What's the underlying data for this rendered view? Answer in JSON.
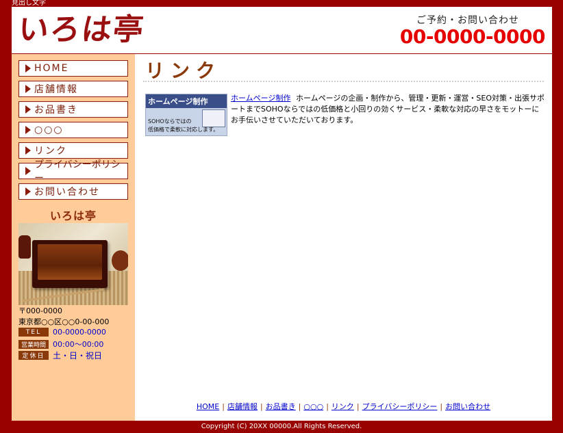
{
  "top_caption": "見出し文字",
  "header": {
    "logo_text": "いろは亭",
    "reserve_label": "ご予約・お問い合わせ",
    "phone": "00-0000-0000"
  },
  "nav": {
    "items": [
      {
        "label": "HOME"
      },
      {
        "label": "店舗情報"
      },
      {
        "label": "お品書き"
      },
      {
        "label": "○○○"
      },
      {
        "label": "リンク"
      },
      {
        "label": "プライバシーポリシー"
      },
      {
        "label": "お問い合わせ"
      }
    ]
  },
  "sidebar": {
    "title": "いろは亭",
    "postal": "〒000-0000",
    "address": "東京都○○区○○0-00-000",
    "tel_label": "TEL",
    "tel_value": "00-0000-0000",
    "hours_label": "営業時間",
    "hours_value": "00:00～00:00",
    "closed_label": "定休日",
    "closed_value": "土・日・祝日"
  },
  "main": {
    "title": "リンク",
    "banner": {
      "title": "ホームページ制作",
      "line1": "SOHOならではの",
      "line2": "低価格で柔軟に対応します。"
    },
    "link_label": "ホームページ制作",
    "link_desc": "ホームページの企画・制作から、管理・更新・運営・SEO対策・出張サポートまでSOHOならではの低価格と小回りの効くサービス・柔軟な対応の早さをモットーにお手伝いさせていただいております。"
  },
  "footer": {
    "links": [
      {
        "label": "HOME"
      },
      {
        "label": "店舗情報"
      },
      {
        "label": "お品書き"
      },
      {
        "label": "○○○"
      },
      {
        "label": "リンク"
      },
      {
        "label": "プライバシーポリシー"
      },
      {
        "label": "お問い合わせ"
      }
    ],
    "separator": "|",
    "copyright": "Copyright (C) 20XX 00000.All Rights Reserved."
  },
  "colors": {
    "frame": "#990000",
    "sidebar_bg": "#ffcc99",
    "accent_brown": "#8a3a0a",
    "phone_red": "#e60000",
    "link_blue": "#0000cc"
  }
}
